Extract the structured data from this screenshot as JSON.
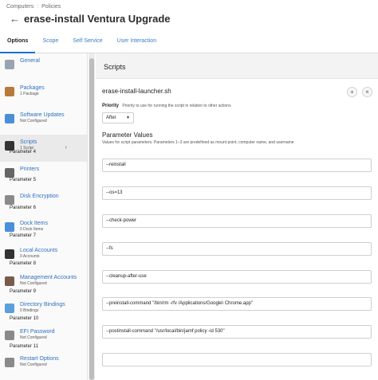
{
  "breadcrumb": {
    "parent": "Computers",
    "current": "Policies"
  },
  "page_title": "erase-install Ventura Upgrade",
  "tabs": [
    "Options",
    "Scope",
    "Self Service",
    "User Interaction"
  ],
  "sidebar": [
    {
      "label": "General",
      "sub": "",
      "icon": "general-icon",
      "color": "#9aa4b0"
    },
    {
      "label": "Packages",
      "sub": "1 Package",
      "icon": "package-icon",
      "color": "#b8793a"
    },
    {
      "label": "Software Updates",
      "sub": "Not Configured",
      "icon": "software-updates-icon",
      "color": "#4a90d9"
    },
    {
      "label": "Scripts",
      "sub": "1 Script",
      "icon": "script-icon",
      "color": "#333333"
    },
    {
      "label": "Printers",
      "sub": "",
      "icon": "printer-icon",
      "color": "#666666"
    },
    {
      "label": "Disk Encryption",
      "sub": "",
      "icon": "disk-encryption-icon",
      "color": "#8a8a8a"
    },
    {
      "label": "Dock Items",
      "sub": "0 Dock Items",
      "icon": "dock-icon",
      "color": "#4a90d9"
    },
    {
      "label": "Local Accounts",
      "sub": "0 Accounts",
      "icon": "local-accounts-icon",
      "color": "#333333"
    },
    {
      "label": "Management Accounts",
      "sub": "Not Configured",
      "icon": "management-accounts-icon",
      "color": "#7a5a4a"
    },
    {
      "label": "Directory Bindings",
      "sub": "0 Bindings",
      "icon": "directory-bindings-icon",
      "color": "#5aa0dd"
    },
    {
      "label": "EFI Password",
      "sub": "Not Configured",
      "icon": "efi-password-icon",
      "color": "#8a8a8a"
    },
    {
      "label": "Restart Options",
      "sub": "Not Configured",
      "icon": "restart-icon",
      "color": "#8a8a8a"
    }
  ],
  "scripts_section": {
    "title": "Scripts",
    "script_name": "erase-install-launcher.sh",
    "priority_label": "Priority",
    "priority_hint": "Priority to use for running the script in relation to other actions",
    "priority_value": "After",
    "parameters_title": "Parameter Values",
    "parameters_desc": "Values for script parameters. Parameters 1–3 are predefined as mount point, computer name, and username",
    "parameters": [
      {
        "label": "Parameter 4",
        "value": "--reinstall"
      },
      {
        "label": "Parameter 5",
        "value": "--os=13"
      },
      {
        "label": "Parameter 6",
        "value": "--check-power"
      },
      {
        "label": "Parameter 7",
        "value": "--fs"
      },
      {
        "label": "Parameter 8",
        "value": "--cleanup-after-use"
      },
      {
        "label": "Parameter 9",
        "value": "--preinstall-command \"/bin/rm -rfv /Applications/Google\\ Chrome.app\""
      },
      {
        "label": "Parameter 10",
        "value": "--postinstall-command \"/usr/local/bin/jamf policy -id 530\""
      },
      {
        "label": "Parameter 11",
        "value": ""
      }
    ]
  }
}
